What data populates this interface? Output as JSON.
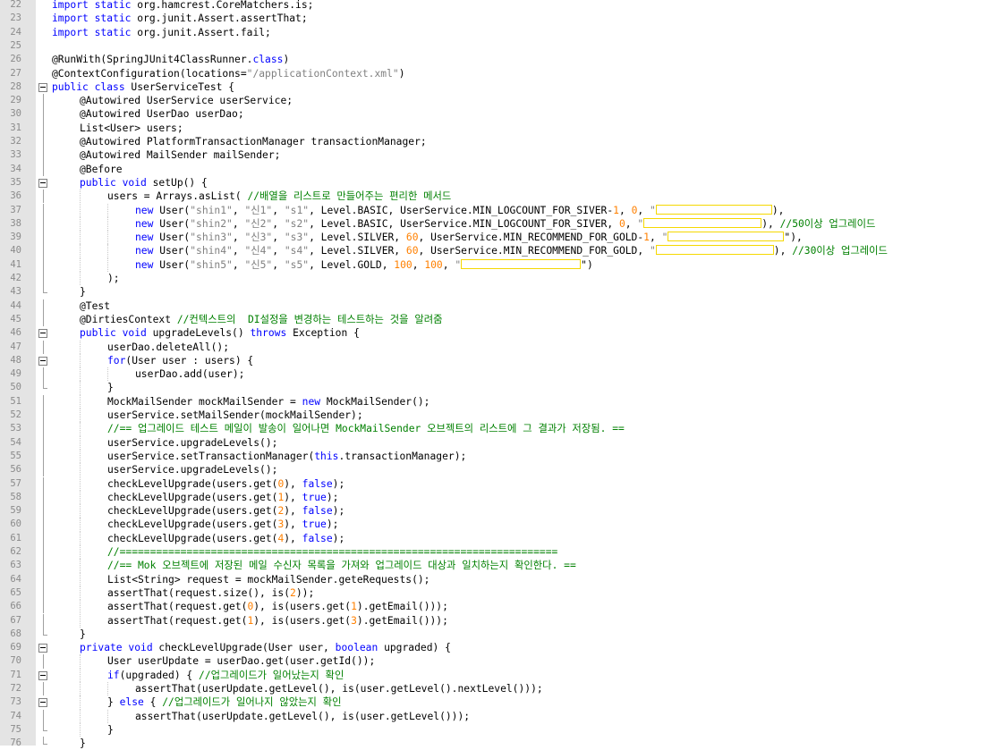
{
  "editor": {
    "lines": [
      {
        "n": "22",
        "indent": 0,
        "fold": "",
        "toks": [
          [
            "kw",
            "import static"
          ],
          [
            "p",
            " org.hamcrest.CoreMatchers.is;"
          ]
        ]
      },
      {
        "n": "23",
        "indent": 0,
        "fold": "",
        "toks": [
          [
            "kw",
            "import static"
          ],
          [
            "p",
            " org.junit.Assert.assertThat;"
          ]
        ]
      },
      {
        "n": "24",
        "indent": 0,
        "fold": "",
        "toks": [
          [
            "kw",
            "import static"
          ],
          [
            "p",
            " org.junit.Assert.fail;"
          ]
        ]
      },
      {
        "n": "25",
        "indent": 0,
        "fold": "",
        "toks": []
      },
      {
        "n": "26",
        "indent": 0,
        "fold": "",
        "toks": [
          [
            "p",
            "@RunWith(SpringJUnit4ClassRunner."
          ],
          [
            "kw",
            "class"
          ],
          [
            "p",
            ")"
          ]
        ]
      },
      {
        "n": "27",
        "indent": 0,
        "fold": "",
        "toks": [
          [
            "p",
            "@ContextConfiguration(locations="
          ],
          [
            "st",
            "\"/applicationContext.xml\""
          ],
          [
            "p",
            ")"
          ]
        ]
      },
      {
        "n": "28",
        "indent": 0,
        "fold": "box",
        "toks": [
          [
            "kw",
            "public class"
          ],
          [
            "p",
            " UserServiceTest {"
          ]
        ]
      },
      {
        "n": "29",
        "indent": 1,
        "fold": "vl",
        "toks": [
          [
            "p",
            "@Autowired UserService userService;"
          ]
        ]
      },
      {
        "n": "30",
        "indent": 1,
        "fold": "vl",
        "toks": [
          [
            "p",
            "@Autowired UserDao userDao;"
          ]
        ]
      },
      {
        "n": "31",
        "indent": 1,
        "fold": "vl",
        "toks": [
          [
            "p",
            "List<User> users;"
          ]
        ]
      },
      {
        "n": "32",
        "indent": 1,
        "fold": "vl",
        "toks": [
          [
            "p",
            "@Autowired PlatformTransactionManager transactionManager;"
          ]
        ]
      },
      {
        "n": "33",
        "indent": 1,
        "fold": "vl",
        "toks": [
          [
            "p",
            "@Autowired MailSender mailSender;"
          ]
        ]
      },
      {
        "n": "34",
        "indent": 1,
        "fold": "vl",
        "toks": [
          [
            "p",
            "@Before"
          ]
        ]
      },
      {
        "n": "35",
        "indent": 1,
        "fold": "box",
        "toks": [
          [
            "kw",
            "public void"
          ],
          [
            "p",
            " setUp() {"
          ]
        ]
      },
      {
        "n": "36",
        "indent": 2,
        "fold": "vl",
        "toks": [
          [
            "p",
            "users = Arrays.asList( "
          ],
          [
            "cm",
            "//배열을 리스트로 만들어주는 편리한 메서드"
          ]
        ]
      },
      {
        "n": "37",
        "indent": 3,
        "fold": "vl",
        "toks": [
          [
            "kw",
            "new"
          ],
          [
            "p",
            " User("
          ],
          [
            "st",
            "\"shin1\""
          ],
          [
            "p",
            ", "
          ],
          [
            "st",
            "\"신1\""
          ],
          [
            "p",
            ", "
          ],
          [
            "st",
            "\"s1\""
          ],
          [
            "p",
            ", Level.BASIC, UserService.MIN_LOGCOUNT_FOR_SIVER-"
          ],
          [
            "nm",
            "1"
          ],
          [
            "p",
            ", "
          ],
          [
            "nm",
            "0"
          ],
          [
            "p",
            ", "
          ],
          [
            "st",
            "\""
          ],
          [
            "hl",
            130
          ],
          [
            "p",
            "),"
          ]
        ]
      },
      {
        "n": "38",
        "indent": 3,
        "fold": "vl",
        "toks": [
          [
            "kw",
            "new"
          ],
          [
            "p",
            " User("
          ],
          [
            "st",
            "\"shin2\""
          ],
          [
            "p",
            ", "
          ],
          [
            "st",
            "\"신2\""
          ],
          [
            "p",
            ", "
          ],
          [
            "st",
            "\"s2\""
          ],
          [
            "p",
            ", Level.BASIC, UserService.MIN_LOGCOUNT_FOR_SIVER, "
          ],
          [
            "nm",
            "0"
          ],
          [
            "p",
            ", "
          ],
          [
            "st",
            "\""
          ],
          [
            "hl",
            132
          ],
          [
            "p",
            "), "
          ],
          [
            "cm",
            "//50이상 업그레이드"
          ]
        ]
      },
      {
        "n": "39",
        "indent": 3,
        "fold": "vl",
        "toks": [
          [
            "kw",
            "new"
          ],
          [
            "p",
            " User("
          ],
          [
            "st",
            "\"shin3\""
          ],
          [
            "p",
            ", "
          ],
          [
            "st",
            "\"신3\""
          ],
          [
            "p",
            ", "
          ],
          [
            "st",
            "\"s3\""
          ],
          [
            "p",
            ", Level.SILVER, "
          ],
          [
            "nm",
            "60"
          ],
          [
            "p",
            ", UserService.MIN_RECOMMEND_FOR_GOLD-"
          ],
          [
            "nm",
            "1"
          ],
          [
            "p",
            ", "
          ],
          [
            "st",
            "\""
          ],
          [
            "hl",
            130
          ],
          [
            "p",
            "\"),"
          ]
        ]
      },
      {
        "n": "40",
        "indent": 3,
        "fold": "vl",
        "toks": [
          [
            "kw",
            "new"
          ],
          [
            "p",
            " User("
          ],
          [
            "st",
            "\"shin4\""
          ],
          [
            "p",
            ", "
          ],
          [
            "st",
            "\"신4\""
          ],
          [
            "p",
            ", "
          ],
          [
            "st",
            "\"s4\""
          ],
          [
            "p",
            ", Level.SILVER, "
          ],
          [
            "nm",
            "60"
          ],
          [
            "p",
            ", UserService.MIN_RECOMMEND_FOR_GOLD, "
          ],
          [
            "st",
            "\""
          ],
          [
            "hl",
            132
          ],
          [
            "p",
            "), "
          ],
          [
            "cm",
            "//30이상 업그레이드"
          ]
        ]
      },
      {
        "n": "41",
        "indent": 3,
        "fold": "vl",
        "toks": [
          [
            "kw",
            "new"
          ],
          [
            "p",
            " User("
          ],
          [
            "st",
            "\"shin5\""
          ],
          [
            "p",
            ", "
          ],
          [
            "st",
            "\"신5\""
          ],
          [
            "p",
            ", "
          ],
          [
            "st",
            "\"s5\""
          ],
          [
            "p",
            ", Level.GOLD, "
          ],
          [
            "nm",
            "100"
          ],
          [
            "p",
            ", "
          ],
          [
            "nm",
            "100"
          ],
          [
            "p",
            ", "
          ],
          [
            "st",
            "\""
          ],
          [
            "hl",
            134
          ],
          [
            "p",
            "\")"
          ]
        ]
      },
      {
        "n": "42",
        "indent": 2,
        "fold": "vl",
        "toks": [
          [
            "p",
            ");"
          ]
        ]
      },
      {
        "n": "43",
        "indent": 1,
        "fold": "end",
        "toks": [
          [
            "p",
            "}"
          ]
        ]
      },
      {
        "n": "44",
        "indent": 1,
        "fold": "vl",
        "toks": [
          [
            "p",
            "@Test"
          ]
        ]
      },
      {
        "n": "45",
        "indent": 1,
        "fold": "vl",
        "toks": [
          [
            "p",
            "@DirtiesContext "
          ],
          [
            "cm",
            "//컨텍스트의  DI설정을 변경하는 테스트하는 것을 알려줌"
          ]
        ]
      },
      {
        "n": "46",
        "indent": 1,
        "fold": "box",
        "toks": [
          [
            "kw",
            "public void"
          ],
          [
            "p",
            " upgradeLevels() "
          ],
          [
            "kw",
            "throws"
          ],
          [
            "p",
            " Exception {"
          ]
        ]
      },
      {
        "n": "47",
        "indent": 2,
        "fold": "vl",
        "toks": [
          [
            "p",
            "userDao.deleteAll();"
          ]
        ]
      },
      {
        "n": "48",
        "indent": 2,
        "fold": "box",
        "toks": [
          [
            "kw",
            "for"
          ],
          [
            "p",
            "(User user : users) {"
          ]
        ]
      },
      {
        "n": "49",
        "indent": 3,
        "fold": "vl",
        "toks": [
          [
            "p",
            "userDao.add(user);"
          ]
        ]
      },
      {
        "n": "50",
        "indent": 2,
        "fold": "end",
        "toks": [
          [
            "p",
            "}"
          ]
        ]
      },
      {
        "n": "51",
        "indent": 2,
        "fold": "vl",
        "toks": [
          [
            "p",
            "MockMailSender mockMailSender = "
          ],
          [
            "kw",
            "new"
          ],
          [
            "p",
            " MockMailSender();"
          ]
        ]
      },
      {
        "n": "52",
        "indent": 2,
        "fold": "vl",
        "toks": [
          [
            "p",
            "userService.setMailSender(mockMailSender);"
          ]
        ]
      },
      {
        "n": "53",
        "indent": 2,
        "fold": "vl",
        "toks": [
          [
            "cm",
            "//== 업그레이드 테스트 메일이 발송이 일어나면 MockMailSender 오브젝트의 리스트에 그 결과가 저장됨. =="
          ]
        ]
      },
      {
        "n": "54",
        "indent": 2,
        "fold": "vl",
        "toks": [
          [
            "p",
            "userService.upgradeLevels();"
          ]
        ]
      },
      {
        "n": "55",
        "indent": 2,
        "fold": "vl",
        "toks": [
          [
            "p",
            "userService.setTransactionManager("
          ],
          [
            "kw",
            "this"
          ],
          [
            "p",
            ".transactionManager);"
          ]
        ]
      },
      {
        "n": "56",
        "indent": 2,
        "fold": "vl",
        "toks": [
          [
            "p",
            "userService.upgradeLevels();"
          ]
        ]
      },
      {
        "n": "57",
        "indent": 2,
        "fold": "vl",
        "toks": [
          [
            "p",
            "checkLevelUpgrade(users.get("
          ],
          [
            "nm",
            "0"
          ],
          [
            "p",
            "), "
          ],
          [
            "kw",
            "false"
          ],
          [
            "p",
            ");"
          ]
        ]
      },
      {
        "n": "58",
        "indent": 2,
        "fold": "vl",
        "toks": [
          [
            "p",
            "checkLevelUpgrade(users.get("
          ],
          [
            "nm",
            "1"
          ],
          [
            "p",
            "), "
          ],
          [
            "kw",
            "true"
          ],
          [
            "p",
            ");"
          ]
        ]
      },
      {
        "n": "59",
        "indent": 2,
        "fold": "vl",
        "toks": [
          [
            "p",
            "checkLevelUpgrade(users.get("
          ],
          [
            "nm",
            "2"
          ],
          [
            "p",
            "), "
          ],
          [
            "kw",
            "false"
          ],
          [
            "p",
            ");"
          ]
        ]
      },
      {
        "n": "60",
        "indent": 2,
        "fold": "vl",
        "toks": [
          [
            "p",
            "checkLevelUpgrade(users.get("
          ],
          [
            "nm",
            "3"
          ],
          [
            "p",
            "), "
          ],
          [
            "kw",
            "true"
          ],
          [
            "p",
            ");"
          ]
        ]
      },
      {
        "n": "61",
        "indent": 2,
        "fold": "vl",
        "toks": [
          [
            "p",
            "checkLevelUpgrade(users.get("
          ],
          [
            "nm",
            "4"
          ],
          [
            "p",
            "), "
          ],
          [
            "kw",
            "false"
          ],
          [
            "p",
            ");"
          ]
        ]
      },
      {
        "n": "62",
        "indent": 2,
        "fold": "vl",
        "toks": [
          [
            "cm",
            "//========================================================================"
          ]
        ]
      },
      {
        "n": "63",
        "indent": 2,
        "fold": "vl",
        "toks": [
          [
            "cm",
            "//== Mok 오브젝트에 저장된 메일 수신자 목록을 가져와 업그레이드 대상과 일치하는지 확인한다. =="
          ]
        ]
      },
      {
        "n": "64",
        "indent": 2,
        "fold": "vl",
        "toks": [
          [
            "p",
            "List<String> request = mockMailSender.geteRequests();"
          ]
        ]
      },
      {
        "n": "65",
        "indent": 2,
        "fold": "vl",
        "toks": [
          [
            "p",
            "assertThat(request.size(), is("
          ],
          [
            "nm",
            "2"
          ],
          [
            "p",
            "));"
          ]
        ]
      },
      {
        "n": "66",
        "indent": 2,
        "fold": "vl",
        "toks": [
          [
            "p",
            "assertThat(request.get("
          ],
          [
            "nm",
            "0"
          ],
          [
            "p",
            "), is(users.get("
          ],
          [
            "nm",
            "1"
          ],
          [
            "p",
            ").getEmail()));"
          ]
        ]
      },
      {
        "n": "67",
        "indent": 2,
        "fold": "vl",
        "toks": [
          [
            "p",
            "assertThat(request.get("
          ],
          [
            "nm",
            "1"
          ],
          [
            "p",
            "), is(users.get("
          ],
          [
            "nm",
            "3"
          ],
          [
            "p",
            ").getEmail()));"
          ]
        ]
      },
      {
        "n": "68",
        "indent": 1,
        "fold": "end",
        "toks": [
          [
            "p",
            "}"
          ]
        ]
      },
      {
        "n": "69",
        "indent": 1,
        "fold": "box",
        "toks": [
          [
            "kw",
            "private void"
          ],
          [
            "p",
            " checkLevelUpgrade(User user, "
          ],
          [
            "kw",
            "boolean"
          ],
          [
            "p",
            " upgraded) {"
          ]
        ]
      },
      {
        "n": "70",
        "indent": 2,
        "fold": "vl",
        "toks": [
          [
            "p",
            "User userUpdate = userDao.get(user.getId());"
          ]
        ]
      },
      {
        "n": "71",
        "indent": 2,
        "fold": "box",
        "toks": [
          [
            "kw",
            "if"
          ],
          [
            "p",
            "(upgraded) { "
          ],
          [
            "cm",
            "//업그레이드가 일어났는지 확인"
          ]
        ]
      },
      {
        "n": "72",
        "indent": 3,
        "fold": "vl",
        "toks": [
          [
            "p",
            "assertThat(userUpdate.getLevel(), is(user.getLevel().nextLevel()));"
          ]
        ]
      },
      {
        "n": "73",
        "indent": 2,
        "fold": "box",
        "toks": [
          [
            "p",
            "} "
          ],
          [
            "kw",
            "else"
          ],
          [
            "p",
            " { "
          ],
          [
            "cm",
            "//업그레이드가 일어나지 않았는지 확인"
          ]
        ]
      },
      {
        "n": "74",
        "indent": 3,
        "fold": "vl",
        "toks": [
          [
            "p",
            "assertThat(userUpdate.getLevel(), is(user.getLevel()));"
          ]
        ]
      },
      {
        "n": "75",
        "indent": 2,
        "fold": "end",
        "toks": [
          [
            "p",
            "}"
          ]
        ]
      },
      {
        "n": "76",
        "indent": 1,
        "fold": "end",
        "toks": [
          [
            "p",
            "}"
          ]
        ]
      }
    ]
  }
}
